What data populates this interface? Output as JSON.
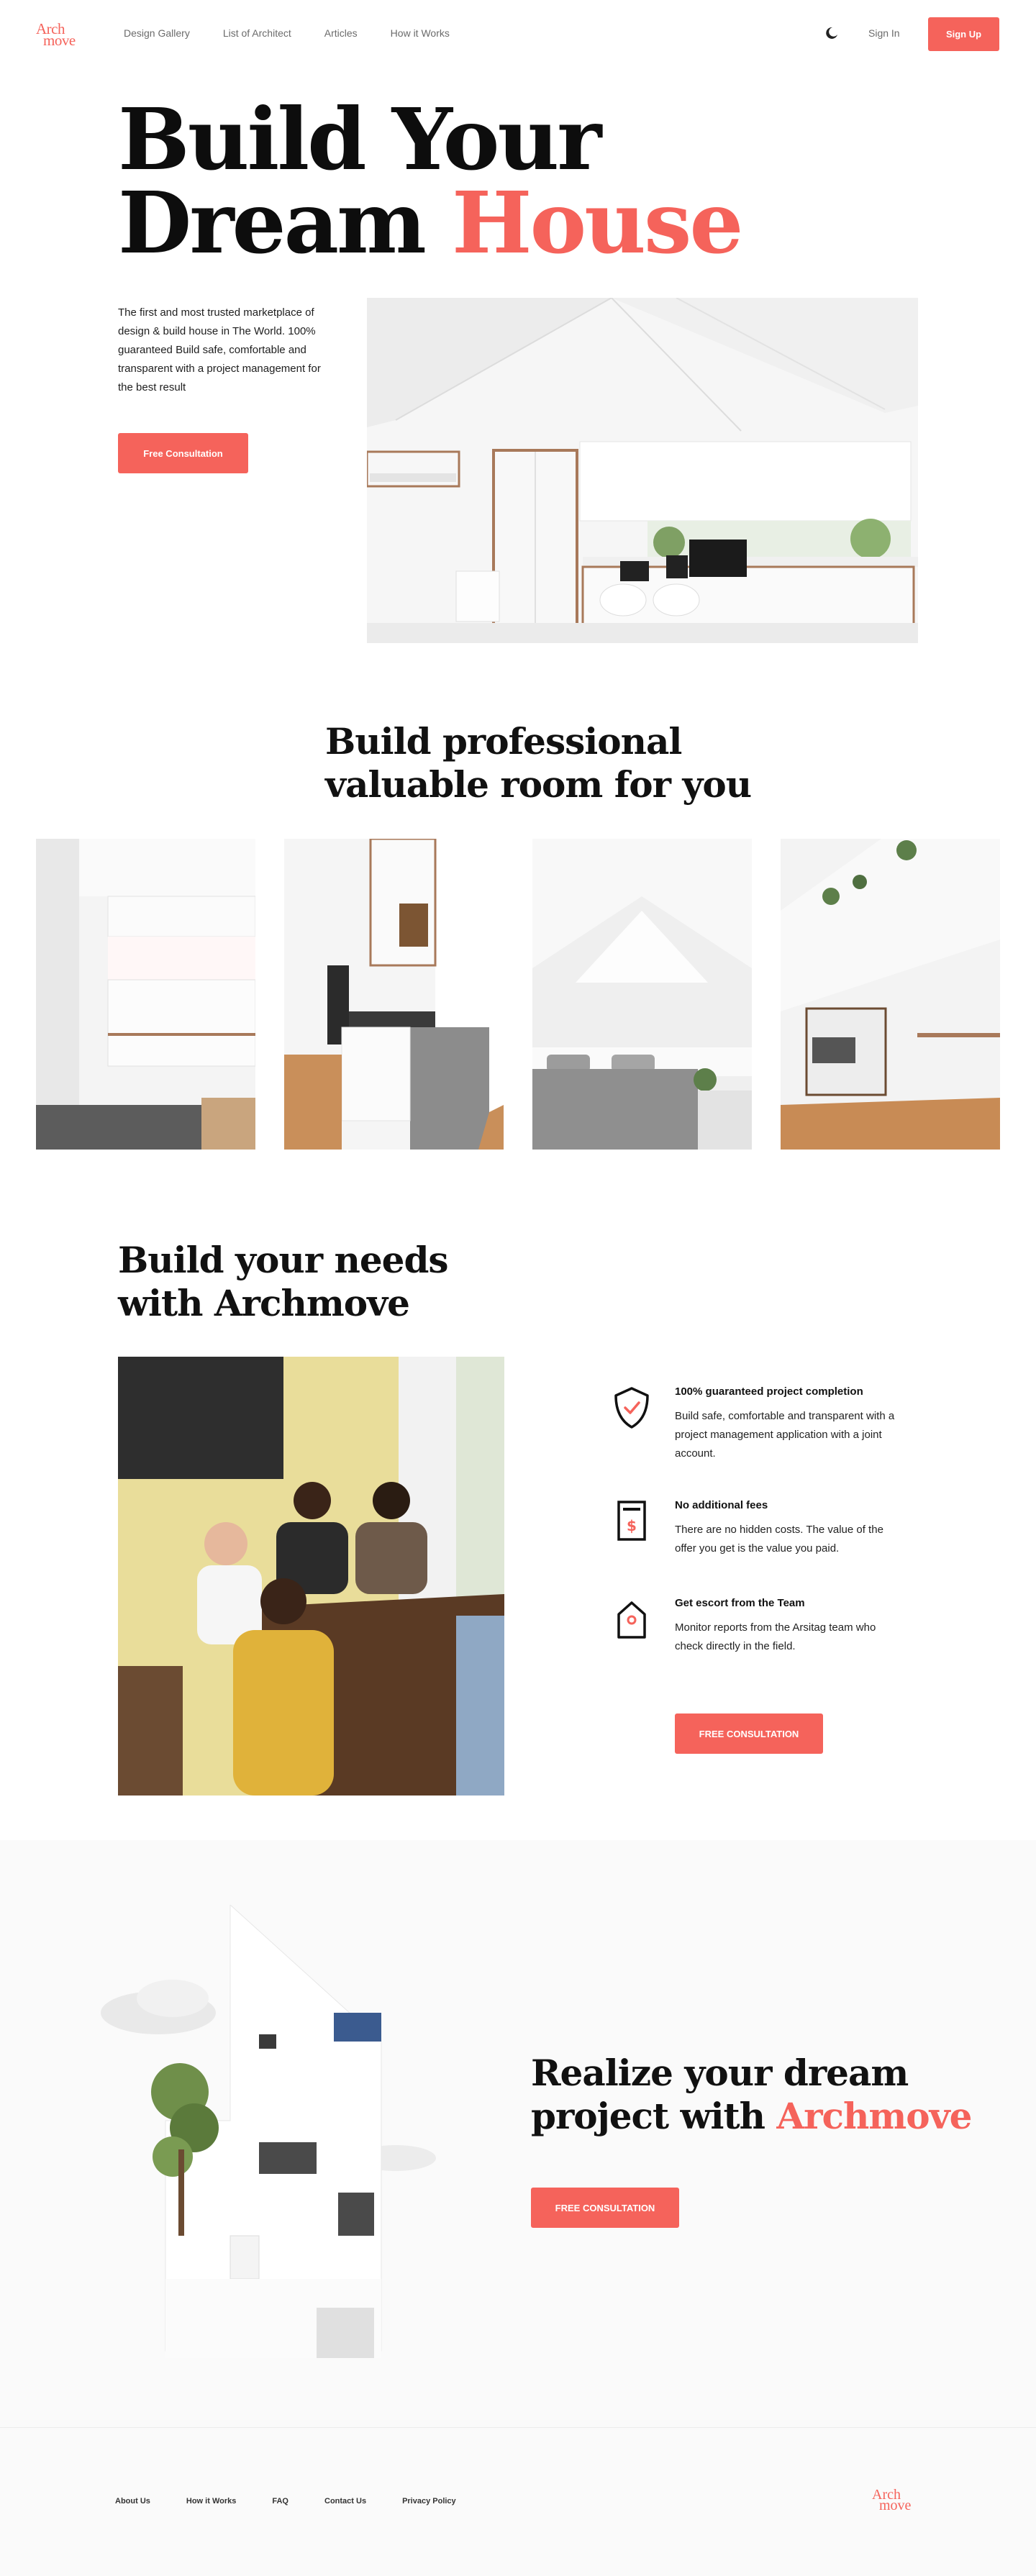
{
  "brand": {
    "logo_line1": "Arch",
    "logo_line2": "move",
    "accent_color": "#f5635b"
  },
  "nav": {
    "links": [
      "Design Gallery",
      "List of Architect",
      "Articles",
      "How it Works"
    ],
    "theme_toggle_icon": "moon-icon",
    "sign_in": "Sign In",
    "sign_up": "Sign Up"
  },
  "hero": {
    "title_line1": "Build Your",
    "title_line2_plain": "Dream ",
    "title_line2_accent": "House",
    "description": "The first and most trusted marketplace of design & build house in The World. 100% guaranteed Build safe, comfortable and transparent with a project management for the best result",
    "cta": "Free Consultation"
  },
  "rooms": {
    "title_line1": "Build professional",
    "title_line2": "valuable room for you"
  },
  "needs": {
    "title_line1": "Build your needs",
    "title_line2": "with Archmove",
    "features": [
      {
        "icon": "shield-check-icon",
        "title": "100% guaranteed project completion",
        "text": "Build safe, comfortable and transparent with a project management application with a joint account."
      },
      {
        "icon": "invoice-dollar-icon",
        "title": "No additional fees",
        "text": "There are no hidden costs. The value of the offer you get is the value you paid."
      },
      {
        "icon": "house-tag-icon",
        "title": "Get escort from the Team",
        "text": "Monitor reports from the Arsitag team who check directly in the field."
      }
    ],
    "cta": "FREE CONSULTATION"
  },
  "realize": {
    "title_line1": "Realize your dream",
    "title_line2_plain": "project with ",
    "title_line2_accent": "Archmove",
    "cta": "FREE CONSULTATION"
  },
  "footer": {
    "links": [
      "About Us",
      "How it Works",
      "FAQ",
      "Contact Us",
      "Privacy Policy"
    ],
    "logo_line1": "Arch",
    "logo_line2": "move"
  }
}
